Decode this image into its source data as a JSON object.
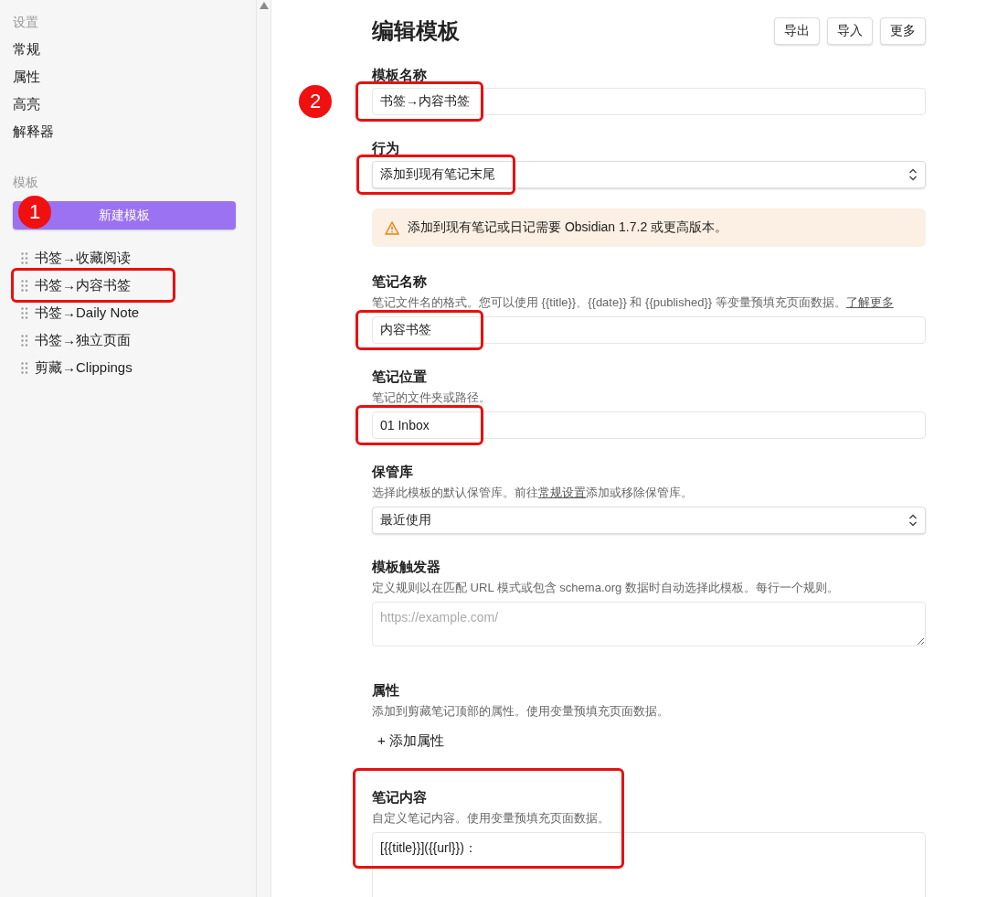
{
  "sidebar": {
    "settings_heading": "设置",
    "settings_items": [
      {
        "label": "常规"
      },
      {
        "label": "属性"
      },
      {
        "label": "高亮"
      },
      {
        "label": "解释器"
      }
    ],
    "templates_heading": "模板",
    "new_template_button": {
      "label": "新建模板",
      "badge": "1"
    },
    "templates": [
      {
        "label": "书签→收藏阅读",
        "highlighted": false
      },
      {
        "label": "书签→内容书签",
        "highlighted": true
      },
      {
        "label": "书签→Daily Note",
        "highlighted": false
      },
      {
        "label": "书签→独立页面",
        "highlighted": false
      },
      {
        "label": "剪藏→Clippings",
        "highlighted": false
      }
    ]
  },
  "main": {
    "title": "编辑模板",
    "buttons": [
      "导出",
      "导入",
      "更多"
    ],
    "fields": [
      {
        "kind": "input",
        "label": "模板名称",
        "value": "书签→内容书签",
        "highlighted": true,
        "badge": "2"
      },
      {
        "kind": "select",
        "label": "行为",
        "value": "添加到现有笔记末尾",
        "highlighted": true
      },
      {
        "kind": "warning",
        "text": "添加到现有笔记或日记需要 Obsidian 1.7.2 或更高版本。"
      },
      {
        "kind": "input",
        "label": "笔记名称",
        "description": [
          {
            "kind": "text",
            "text": "笔记文件名的格式。您可以使用 {{title}}、{{date}} 和 {{published}} 等变量预填充页面数据。"
          },
          {
            "kind": "link",
            "text": "了解更多"
          }
        ],
        "value": "内容书签",
        "highlighted": true
      },
      {
        "kind": "input",
        "label": "笔记位置",
        "description": [
          {
            "kind": "text",
            "text": "笔记的文件夹或路径。"
          }
        ],
        "value": "01 Inbox",
        "highlighted": true
      },
      {
        "kind": "select",
        "label": "保管库",
        "description": [
          {
            "kind": "text",
            "text": "选择此模板的默认保管库。前往"
          },
          {
            "kind": "link",
            "text": "常规设置"
          },
          {
            "kind": "text",
            "text": "添加或移除保管库。"
          }
        ],
        "value": "最近使用"
      },
      {
        "kind": "textarea",
        "label": "模板触发器",
        "description": [
          {
            "kind": "text",
            "text": "定义规则以在匹配 URL 模式或包含 schema.org 数据时自动选择此模板。每行一个规则。"
          }
        ],
        "placeholder": "https://example.com/"
      },
      {
        "kind": "properties",
        "label": "属性",
        "description": [
          {
            "kind": "text",
            "text": "添加到剪藏笔记顶部的属性。使用变量预填充页面数据。"
          }
        ],
        "add_button": "+ 添加属性"
      },
      {
        "kind": "content",
        "label": "笔记内容",
        "description": [
          {
            "kind": "text",
            "text": "自定义笔记内容。使用变量预填充页面数据。"
          }
        ],
        "value": "[{{title}}]({{url}})：",
        "highlighted": true
      }
    ]
  }
}
